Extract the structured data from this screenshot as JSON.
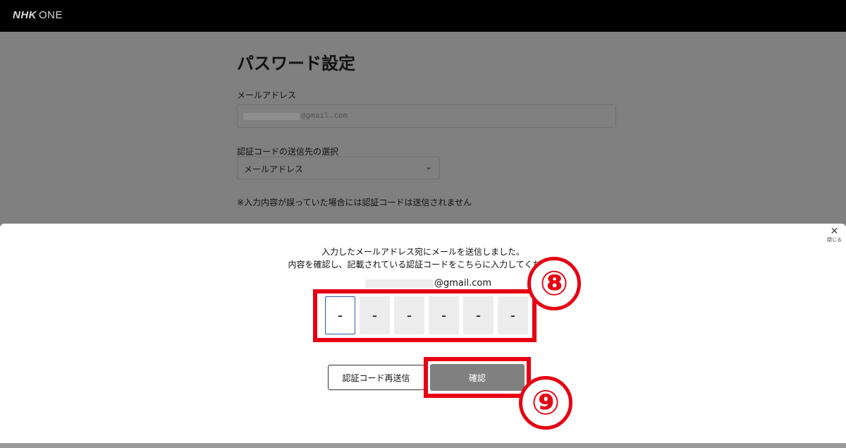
{
  "header": {
    "logo_bold": "NHK",
    "logo_text": "ONE"
  },
  "page": {
    "title": "パスワード設定",
    "email_label": "メールアドレス",
    "email_value_suffix": "@gmail.com",
    "send_target_label": "認証コードの送信先の選択",
    "send_target_value": "メールアドレス",
    "note": "※入力内容が誤っていた場合には認証コードは送信されません"
  },
  "modal": {
    "close_label": "閉じる",
    "message_line1": "入力したメールアドレス宛にメールを送信しました。",
    "message_line2": "内容を確認し、記載されている認証コードをこちらに入力してください",
    "sent_email_suffix": "@gmail.com",
    "code_digits": [
      "-",
      "-",
      "-",
      "-",
      "-",
      "-"
    ],
    "resend_label": "認証コード再送信",
    "confirm_label": "確認"
  },
  "annotations": {
    "step8": "⑧",
    "step9": "⑨",
    "highlight_color": "#e60012"
  }
}
